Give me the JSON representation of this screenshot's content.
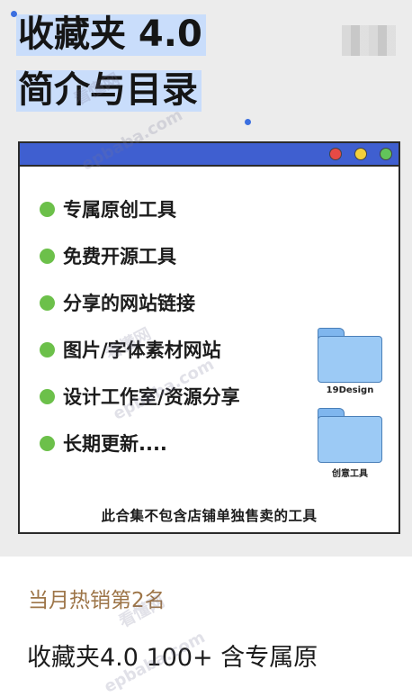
{
  "card": {
    "title_line1": "收藏夹 4.0",
    "title_line2": "简介与目录",
    "window": {
      "items": [
        {
          "text": "专属原创工具"
        },
        {
          "text": "免费开源工具"
        },
        {
          "text": "分享的网站链接"
        },
        {
          "text": "图片/字体素材网站"
        },
        {
          "text": "设计工作室/资源分享"
        },
        {
          "text": "长期更新...."
        }
      ],
      "folders": [
        {
          "label": "19Design",
          "icon": "folder-icon"
        },
        {
          "label": "创意工具",
          "icon": "folder-icon"
        }
      ],
      "footer_note": "此合集不包含店铺单独售卖的工具"
    }
  },
  "listing": {
    "badge": "当月热销第2名",
    "product_title": "收藏夹4.0 100+ 含专属原"
  },
  "watermarks": [
    "看懂网",
    "epbaba.com",
    "看懂网",
    "epbaba.com",
    "看懂网",
    "epbaba.com"
  ],
  "colors": {
    "title_highlight": "#c9ddfb",
    "window_bar": "#3f5fd0",
    "bullet": "#6cc04a",
    "badge_text": "#9d7548",
    "folder": "#9ccaf5"
  }
}
